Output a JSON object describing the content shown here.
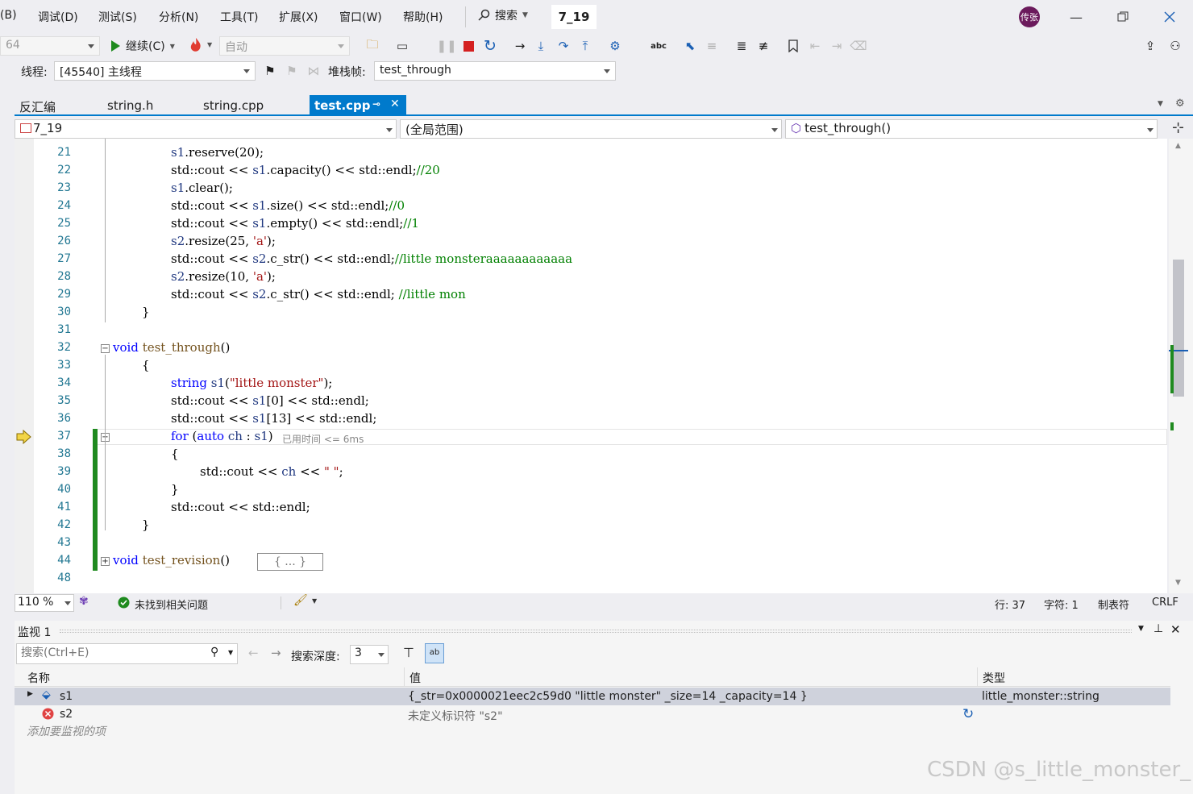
{
  "menubar": {
    "items": [
      "(B)",
      "调试(D)",
      "测试(S)",
      "分析(N)",
      "工具(T)",
      "扩展(X)",
      "窗口(W)",
      "帮助(H)"
    ],
    "search_label": "搜索",
    "solution_name": "7_19",
    "avatar_text": "传张"
  },
  "toolbar1": {
    "platform": "64",
    "continue_label": "继续(C)",
    "auto_label": "自动"
  },
  "toolbar2": {
    "thread_label": "线程:",
    "thread_value": "[45540] 主线程",
    "stackframe_label": "堆栈帧:",
    "stackframe_value": "test_through"
  },
  "tabs": {
    "items": [
      "反汇编",
      "string.h",
      "string.cpp",
      "test.cpp"
    ],
    "active_index": 3
  },
  "navbar": {
    "project": "7_19",
    "scope": "(全局范围)",
    "member": "test_through()"
  },
  "editor": {
    "lines": [
      {
        "no": "21",
        "code": "s1.reserve(20);"
      },
      {
        "no": "22",
        "code": "std::cout << s1.capacity() << std::endl;//20"
      },
      {
        "no": "23",
        "code": "s1.clear();"
      },
      {
        "no": "24",
        "code": "std::cout << s1.size() << std::endl;//0"
      },
      {
        "no": "25",
        "code": "std::cout << s1.empty() << std::endl;//1"
      },
      {
        "no": "26",
        "code": "s2.resize(25, 'a');"
      },
      {
        "no": "27",
        "code": "std::cout << s2.c_str() << std::endl;//little monsteraaaaaaaaaaaa"
      },
      {
        "no": "28",
        "code": "s2.resize(10, 'a');"
      },
      {
        "no": "29",
        "code": "std::cout << s2.c_str() << std::endl; //little mon"
      },
      {
        "no": "30",
        "code": "}"
      },
      {
        "no": "31",
        "code": ""
      },
      {
        "no": "32",
        "code": "void test_through()"
      },
      {
        "no": "33",
        "code": "{"
      },
      {
        "no": "34",
        "code": "string s1(\"little monster\");"
      },
      {
        "no": "35",
        "code": "std::cout << s1[0] << std::endl;"
      },
      {
        "no": "36",
        "code": "std::cout << s1[13] << std::endl;"
      },
      {
        "no": "37",
        "code": "for (auto ch : s1)"
      },
      {
        "no": "38",
        "code": "{"
      },
      {
        "no": "39",
        "code": "std::cout << ch << \" \";"
      },
      {
        "no": "40",
        "code": "}"
      },
      {
        "no": "41",
        "code": "std::cout << std::endl;"
      },
      {
        "no": "42",
        "code": "}"
      },
      {
        "no": "43",
        "code": ""
      },
      {
        "no": "44",
        "code": "void test_revision()"
      },
      {
        "no": "48",
        "code": ""
      }
    ],
    "elapsed_hint": "已用时间 <= 6ms",
    "collapsed_block": "{ ... }"
  },
  "statusbar": {
    "zoom": "110 %",
    "issues": "未找到相关问题",
    "line": "行: 37",
    "char": "字符: 1",
    "tabs": "制表符",
    "eol": "CRLF"
  },
  "watch": {
    "title": "监视 1",
    "search_placeholder": "搜索(Ctrl+E)",
    "depth_label": "搜索深度:",
    "depth_value": "3",
    "columns": [
      "名称",
      "值",
      "类型"
    ],
    "rows": [
      {
        "name": "s1",
        "value": "{_str=0x0000021eec2c59d0 \"little monster\" _size=14 _capacity=14 }",
        "type": "little_monster::string"
      },
      {
        "name": "s2",
        "value": "未定义标识符 \"s2\"",
        "type": ""
      }
    ],
    "add_hint": "添加要监视的项"
  },
  "watermark": "CSDN @s_little_monster_",
  "colors": {
    "accent": "#007acc",
    "change_bar": "#1f8a1f",
    "avatar": "#6b1a5c"
  }
}
